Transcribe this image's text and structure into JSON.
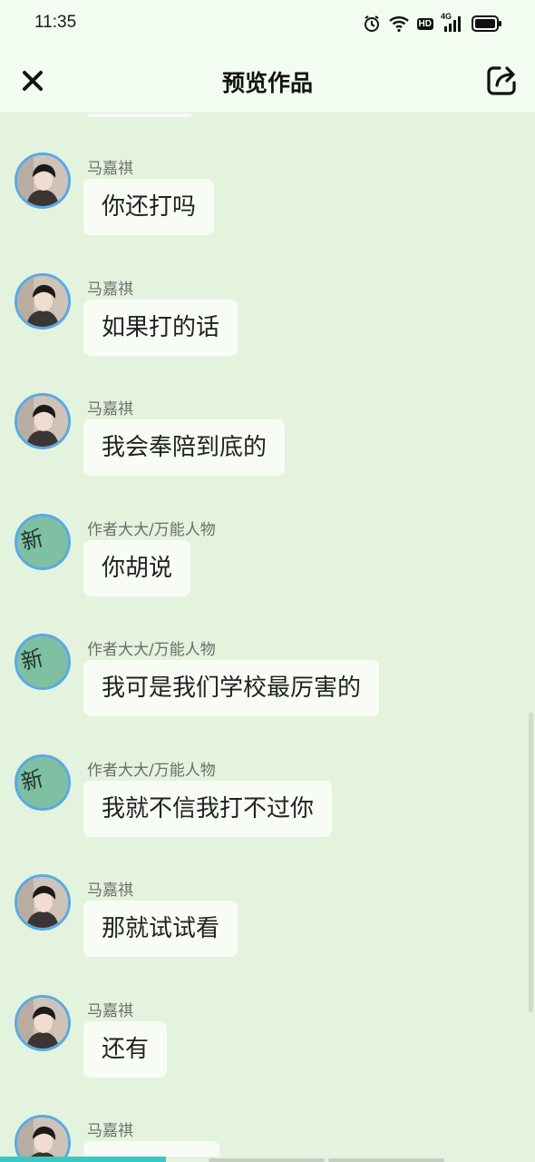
{
  "status_bar": {
    "time": "11:35",
    "icons": [
      "alarm-icon",
      "wifi-icon",
      "hd-icon",
      "signal-4g-icon",
      "battery-icon"
    ],
    "hd_label": "HD",
    "network_label": "4G"
  },
  "header": {
    "title": "预览作品",
    "close_icon": "close-icon",
    "share_icon": "share-icon"
  },
  "messages": [
    {
      "sender": "马嘉祺",
      "avatar": "photo",
      "text": "你还打吗"
    },
    {
      "sender": "马嘉祺",
      "avatar": "photo",
      "text": "如果打的话"
    },
    {
      "sender": "马嘉祺",
      "avatar": "photo",
      "text": "我会奉陪到底的"
    },
    {
      "sender": "作者大大/万能人物",
      "avatar": "新",
      "text": "你胡说"
    },
    {
      "sender": "作者大大/万能人物",
      "avatar": "新",
      "text": "我可是我们学校最厉害的"
    },
    {
      "sender": "作者大大/万能人物",
      "avatar": "新",
      "text": "我就不信我打不过你"
    },
    {
      "sender": "马嘉祺",
      "avatar": "photo",
      "text": "那就试试看"
    },
    {
      "sender": "马嘉祺",
      "avatar": "photo",
      "text": "还有"
    },
    {
      "sender": "马嘉祺",
      "avatar": "photo",
      "text": ""
    }
  ],
  "colors": {
    "background": "#e4f3dd",
    "bar": "#f3fcf0",
    "bubble": "#f7fdf5",
    "avatar_ring": "#5aa9e6",
    "progress": "#36c9c6"
  },
  "progress": {
    "fraction": 0.31
  }
}
